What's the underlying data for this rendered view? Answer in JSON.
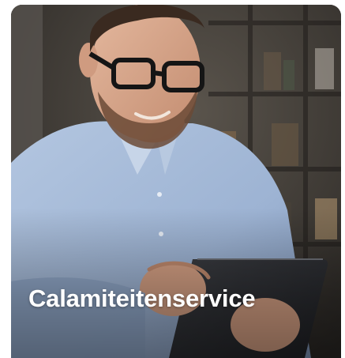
{
  "card": {
    "title": "Calamiteitenservice"
  },
  "photo": {
    "subject": "man-with-glasses-using-tablet",
    "colors": {
      "shirt": "#9fb6d6",
      "background": "#3a3632",
      "skin": "#d4a084",
      "tablet": "#2b2c30"
    }
  }
}
